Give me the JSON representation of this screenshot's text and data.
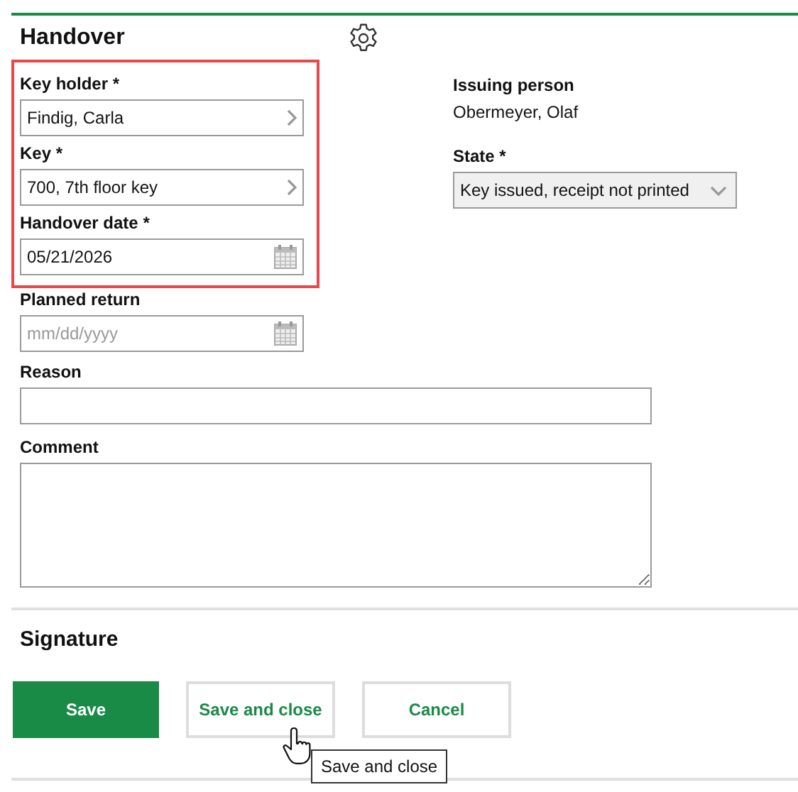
{
  "section_title": "Handover",
  "highlighted_fields": [
    {
      "kind": "picker",
      "label": "Key holder *",
      "value": "Findig, Carla"
    },
    {
      "kind": "picker",
      "label": "Key *",
      "value": "700, 7th floor key"
    },
    {
      "kind": "date",
      "label": "Handover date *",
      "value": "05/21/2026"
    }
  ],
  "fields": [
    {
      "kind": "date",
      "label": "Planned return",
      "placeholder": "mm/dd/yyyy"
    }
  ],
  "issuing_person": {
    "label": "Issuing person",
    "value": "Obermeyer, Olaf"
  },
  "state": {
    "label": "State *",
    "value": "Key issued, receipt not printed"
  },
  "reason": {
    "label": "Reason"
  },
  "comment": {
    "label": "Comment"
  },
  "signature_title": "Signature",
  "buttons": [
    {
      "kind": "primary",
      "label": "Save",
      "hovered": false
    },
    {
      "kind": "secondary",
      "label": "Save and close",
      "hovered": true
    },
    {
      "kind": "secondary",
      "label": "Cancel",
      "hovered": false
    }
  ],
  "tooltip": "Save and close"
}
